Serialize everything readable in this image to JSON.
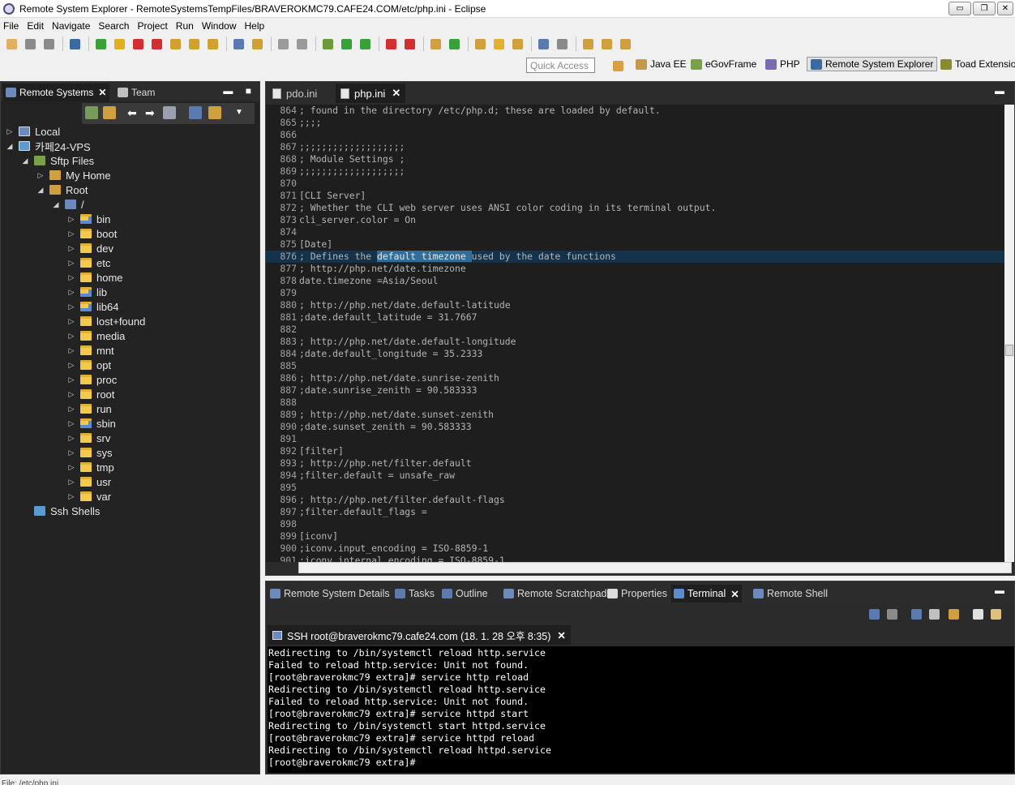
{
  "window": {
    "title": "Remote System Explorer - RemoteSystemsTempFiles/BRAVEROKMC79.CAFE24.COM/etc/php.ini - Eclipse",
    "buttons": [
      "▭",
      "❐",
      "✕"
    ]
  },
  "menu": [
    "File",
    "Edit",
    "Navigate",
    "Search",
    "Project",
    "Run",
    "Window",
    "Help"
  ],
  "quick_access": "Quick Access",
  "perspectives": [
    {
      "label": "Java EE",
      "color": "#c49a4a"
    },
    {
      "label": "eGovFrame",
      "color": "#7aa04a"
    },
    {
      "label": "PHP",
      "color": "#7a6ab0"
    },
    {
      "label": "Remote System Explorer",
      "color": "#3a6aa0",
      "active": true
    },
    {
      "label": "Toad Extension",
      "color": "#8a8a30"
    }
  ],
  "left_panel": {
    "tabs": [
      {
        "label": "Remote Systems",
        "active": true
      },
      {
        "label": "Team",
        "active": false
      }
    ],
    "tree": [
      {
        "label": "Local",
        "depth": 0,
        "twisty": "▷",
        "icon": "computer"
      },
      {
        "label": "카페24-VPS",
        "depth": 0,
        "twisty": "◢",
        "icon": "server"
      },
      {
        "label": "Sftp Files",
        "depth": 1,
        "twisty": "◢",
        "icon": "sftp"
      },
      {
        "label": "My Home",
        "depth": 2,
        "twisty": "▷",
        "icon": "filter"
      },
      {
        "label": "Root",
        "depth": 2,
        "twisty": "◢",
        "icon": "filter"
      },
      {
        "label": "/",
        "depth": 3,
        "twisty": "◢",
        "icon": "root"
      },
      {
        "label": "bin",
        "depth": 4,
        "twisty": "▷",
        "icon": "folder-special"
      },
      {
        "label": "boot",
        "depth": 4,
        "twisty": "▷",
        "icon": "folder"
      },
      {
        "label": "dev",
        "depth": 4,
        "twisty": "▷",
        "icon": "folder"
      },
      {
        "label": "etc",
        "depth": 4,
        "twisty": "▷",
        "icon": "folder"
      },
      {
        "label": "home",
        "depth": 4,
        "twisty": "▷",
        "icon": "folder"
      },
      {
        "label": "lib",
        "depth": 4,
        "twisty": "▷",
        "icon": "folder-special"
      },
      {
        "label": "lib64",
        "depth": 4,
        "twisty": "▷",
        "icon": "folder-special"
      },
      {
        "label": "lost+found",
        "depth": 4,
        "twisty": "▷",
        "icon": "folder"
      },
      {
        "label": "media",
        "depth": 4,
        "twisty": "▷",
        "icon": "folder"
      },
      {
        "label": "mnt",
        "depth": 4,
        "twisty": "▷",
        "icon": "folder"
      },
      {
        "label": "opt",
        "depth": 4,
        "twisty": "▷",
        "icon": "folder"
      },
      {
        "label": "proc",
        "depth": 4,
        "twisty": "▷",
        "icon": "folder"
      },
      {
        "label": "root",
        "depth": 4,
        "twisty": "▷",
        "icon": "folder"
      },
      {
        "label": "run",
        "depth": 4,
        "twisty": "▷",
        "icon": "folder"
      },
      {
        "label": "sbin",
        "depth": 4,
        "twisty": "▷",
        "icon": "folder-special"
      },
      {
        "label": "srv",
        "depth": 4,
        "twisty": "▷",
        "icon": "folder"
      },
      {
        "label": "sys",
        "depth": 4,
        "twisty": "▷",
        "icon": "folder"
      },
      {
        "label": "tmp",
        "depth": 4,
        "twisty": "▷",
        "icon": "folder"
      },
      {
        "label": "usr",
        "depth": 4,
        "twisty": "▷",
        "icon": "folder"
      },
      {
        "label": "var",
        "depth": 4,
        "twisty": "▷",
        "icon": "folder"
      },
      {
        "label": "Ssh Shells",
        "depth": 1,
        "twisty": "",
        "icon": "shell"
      }
    ]
  },
  "editor": {
    "tabs": [
      {
        "label": "pdo.ini",
        "active": false
      },
      {
        "label": "php.ini",
        "active": true
      }
    ],
    "lines": [
      {
        "n": "864",
        "t": "; found in the directory /etc/php.d; these are loaded by default."
      },
      {
        "n": "865",
        "t": ";;;;"
      },
      {
        "n": "866",
        "t": ""
      },
      {
        "n": "867",
        "t": ";;;;;;;;;;;;;;;;;;;"
      },
      {
        "n": "868",
        "t": "; Module Settings ;"
      },
      {
        "n": "869",
        "t": ";;;;;;;;;;;;;;;;;;;"
      },
      {
        "n": "870",
        "t": ""
      },
      {
        "n": "871",
        "t": "[CLI Server]"
      },
      {
        "n": "872",
        "t": "; Whether the CLI web server uses ANSI color coding in its terminal output."
      },
      {
        "n": "873",
        "t": "cli_server.color = On"
      },
      {
        "n": "874",
        "t": ""
      },
      {
        "n": "875",
        "t": "[Date]"
      },
      {
        "n": "876",
        "t": "; Defines the ",
        "sel": "default timezone ",
        "after": "used by the date functions",
        "hl": true
      },
      {
        "n": "877",
        "t": "; http://php.net/date.timezone"
      },
      {
        "n": "878",
        "t": "date.timezone =Asia/Seoul"
      },
      {
        "n": "879",
        "t": ""
      },
      {
        "n": "880",
        "t": "; http://php.net/date.default-latitude"
      },
      {
        "n": "881",
        "t": ";date.default_latitude = 31.7667"
      },
      {
        "n": "882",
        "t": ""
      },
      {
        "n": "883",
        "t": "; http://php.net/date.default-longitude"
      },
      {
        "n": "884",
        "t": ";date.default_longitude = 35.2333"
      },
      {
        "n": "885",
        "t": ""
      },
      {
        "n": "886",
        "t": "; http://php.net/date.sunrise-zenith"
      },
      {
        "n": "887",
        "t": ";date.sunrise_zenith = 90.583333"
      },
      {
        "n": "888",
        "t": ""
      },
      {
        "n": "889",
        "t": "; http://php.net/date.sunset-zenith"
      },
      {
        "n": "890",
        "t": ";date.sunset_zenith = 90.583333"
      },
      {
        "n": "891",
        "t": ""
      },
      {
        "n": "892",
        "t": "[filter]"
      },
      {
        "n": "893",
        "t": "; http://php.net/filter.default"
      },
      {
        "n": "894",
        "t": ";filter.default = unsafe_raw"
      },
      {
        "n": "895",
        "t": ""
      },
      {
        "n": "896",
        "t": "; http://php.net/filter.default-flags"
      },
      {
        "n": "897",
        "t": ";filter.default_flags ="
      },
      {
        "n": "898",
        "t": ""
      },
      {
        "n": "899",
        "t": "[iconv]"
      },
      {
        "n": "900",
        "t": ";iconv.input_encoding = ISO-8859-1"
      },
      {
        "n": "901",
        "t": ";iconv.internal_encoding = ISO-8859-1"
      }
    ]
  },
  "bottom_panel": {
    "tabs": [
      {
        "label": "Remote System Details",
        "active": false
      },
      {
        "label": "Tasks",
        "active": false
      },
      {
        "label": "Outline",
        "active": false
      },
      {
        "label": "Remote Scratchpad",
        "active": false
      },
      {
        "label": "Properties",
        "active": false
      },
      {
        "label": "Terminal",
        "active": true
      },
      {
        "label": "Remote Shell",
        "active": false
      }
    ],
    "session_tab": "SSH root@braverokmc79.cafe24.com (18. 1. 28 오후 8:35)",
    "terminal_lines": [
      "Redirecting to /bin/systemctl reload http.service",
      "Failed to reload http.service: Unit not found.",
      "[root@braverokmc79 extra]# service http reload",
      "Redirecting to /bin/systemctl reload http.service",
      "Failed to reload http.service: Unit not found.",
      "[root@braverokmc79 extra]# service httpd start",
      "Redirecting to /bin/systemctl start httpd.service",
      "[root@braverokmc79 extra]# service httpd reload",
      "Redirecting to /bin/systemctl reload httpd.service",
      "[root@braverokmc79 extra]#"
    ]
  },
  "status": "File: /etc/php.ini"
}
